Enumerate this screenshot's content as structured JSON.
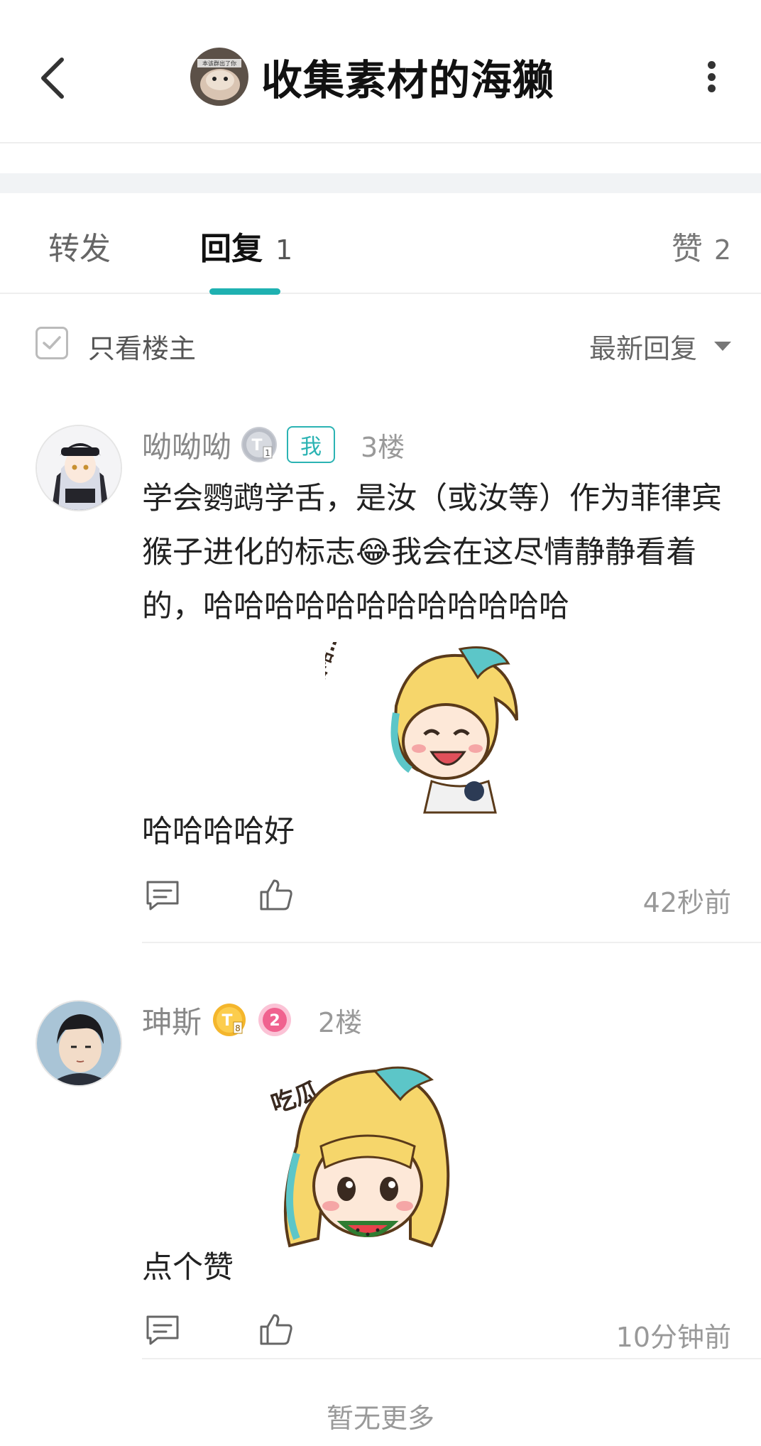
{
  "header": {
    "back_icon": "chevron-left-icon",
    "avatar_caption": "本该群出了你",
    "title": "收集素材的海獭",
    "more_icon": "more-vertical-icon"
  },
  "tabs": {
    "forward_label": "转发",
    "reply_label": "回复",
    "reply_count": "1",
    "like_label": "赞",
    "like_count": "2",
    "accent_color": "#1fb1b1"
  },
  "filter": {
    "only_op_label": "只看楼主",
    "sort_label": "最新回复"
  },
  "posts": [
    {
      "username": "呦呦呦",
      "level": "1",
      "me_tag": "我",
      "floor": "3楼",
      "text": "学会鹦鹉学舌，是汝（或汝等）作为菲律宾猴子进化的标志😂我会在这尽情静静看着的，哈哈哈哈哈哈哈哈哈哈哈哈",
      "sticker_text": "哈哈哈哈哈…",
      "tail": "哈哈哈哈好",
      "time": "42秒前"
    },
    {
      "username": "珅斯",
      "level": "8",
      "fan_level": "2",
      "floor": "2楼",
      "sticker_text": "吃瓜…",
      "tail": "点个赞",
      "time": "10分钟前"
    }
  ],
  "footer": {
    "no_more": "暂无更多"
  }
}
